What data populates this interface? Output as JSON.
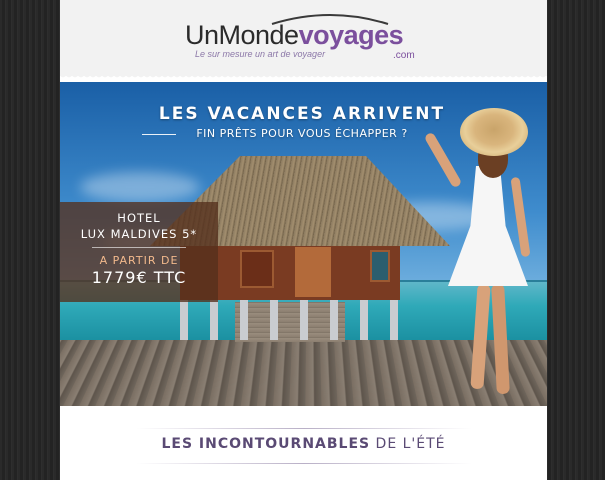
{
  "logo": {
    "part1": "Un",
    "part2": "Monde",
    "part3": "voyages",
    "suffix": ".com",
    "tagline": "Le sur mesure un art de voyager",
    "brand_color": "#7b4f9d"
  },
  "hero": {
    "headline": "LES VACANCES ARRIVENT",
    "subheadline": "FIN PRÊTS POUR VOUS ÉCHAPPER ?",
    "offer": {
      "hotel_line1": "HOTEL",
      "hotel_line2": "LUX MALDIVES 5*",
      "from_label": "A PARTIR DE",
      "price": "1779€ TTC",
      "accent_color": "#f2b98c"
    }
  },
  "section": {
    "title_bold": "LES INCONTOURNABLES",
    "title_rest": " DE L'ÉTÉ"
  }
}
